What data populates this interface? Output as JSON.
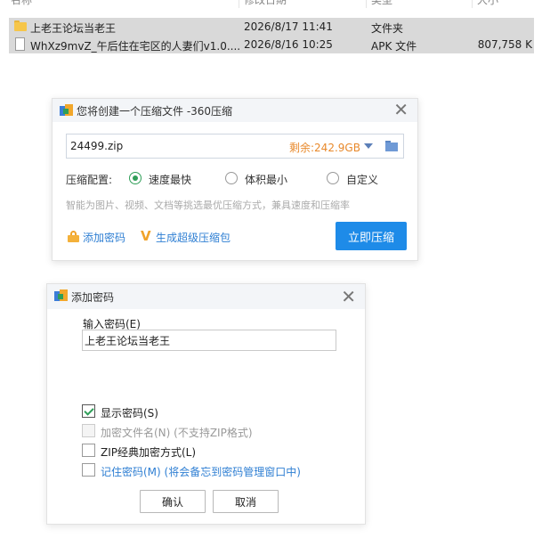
{
  "file_list": {
    "headers": [
      "名称",
      "修改日期",
      "类型",
      "大小"
    ],
    "rows": [
      {
        "name": "上老王论坛当老王",
        "date": "2026/8/17 11:41",
        "type": "文件夹",
        "size": "",
        "icon": "folder-icon"
      },
      {
        "name": "WhXz9mvZ_午后住在宅区的人妻们v1.0....",
        "date": "2026/8/16 10:25",
        "type": "APK 文件",
        "size": "807,758 K",
        "icon": "file-icon"
      }
    ]
  },
  "compress_dialog": {
    "title": "您将创建一个压缩文件 -360压缩",
    "filename": "24499.zip",
    "free_space": "剩余:242.9GB",
    "config_label": "压缩配置:",
    "options": [
      {
        "label": "速度最快",
        "selected": true
      },
      {
        "label": "体积最小",
        "selected": false
      },
      {
        "label": "自定义",
        "selected": false
      }
    ],
    "hint": "智能为图片、视频、文档等挑选最优压缩方式，兼具速度和压缩率",
    "add_password_link": "添加密码",
    "super_pack_link": "生成超级压缩包",
    "compress_button": "立即压缩",
    "close_glyph": "✕"
  },
  "password_dialog": {
    "title": "添加密码",
    "input_label": "输入密码(E)",
    "password_value": "上老王论坛当老王",
    "checkboxes": [
      {
        "label": "显示密码(S)",
        "checked": true,
        "disabled": false
      },
      {
        "label": "加密文件名(N) (不支持ZIP格式)",
        "checked": false,
        "disabled": true
      },
      {
        "label": "ZIP经典加密方式(L)",
        "checked": false,
        "disabled": false
      },
      {
        "label": "记住密码(M) (将会备忘到密码管理窗口中)",
        "checked": false,
        "disabled": false
      }
    ],
    "ok_button": "确认",
    "cancel_button": "取消",
    "close_glyph": "✕"
  },
  "colors": {
    "accent_blue": "#1e8be8",
    "radio_green": "#2f9e58",
    "free_space_orange": "#e8892b",
    "link_blue": "#2f7fd3"
  }
}
